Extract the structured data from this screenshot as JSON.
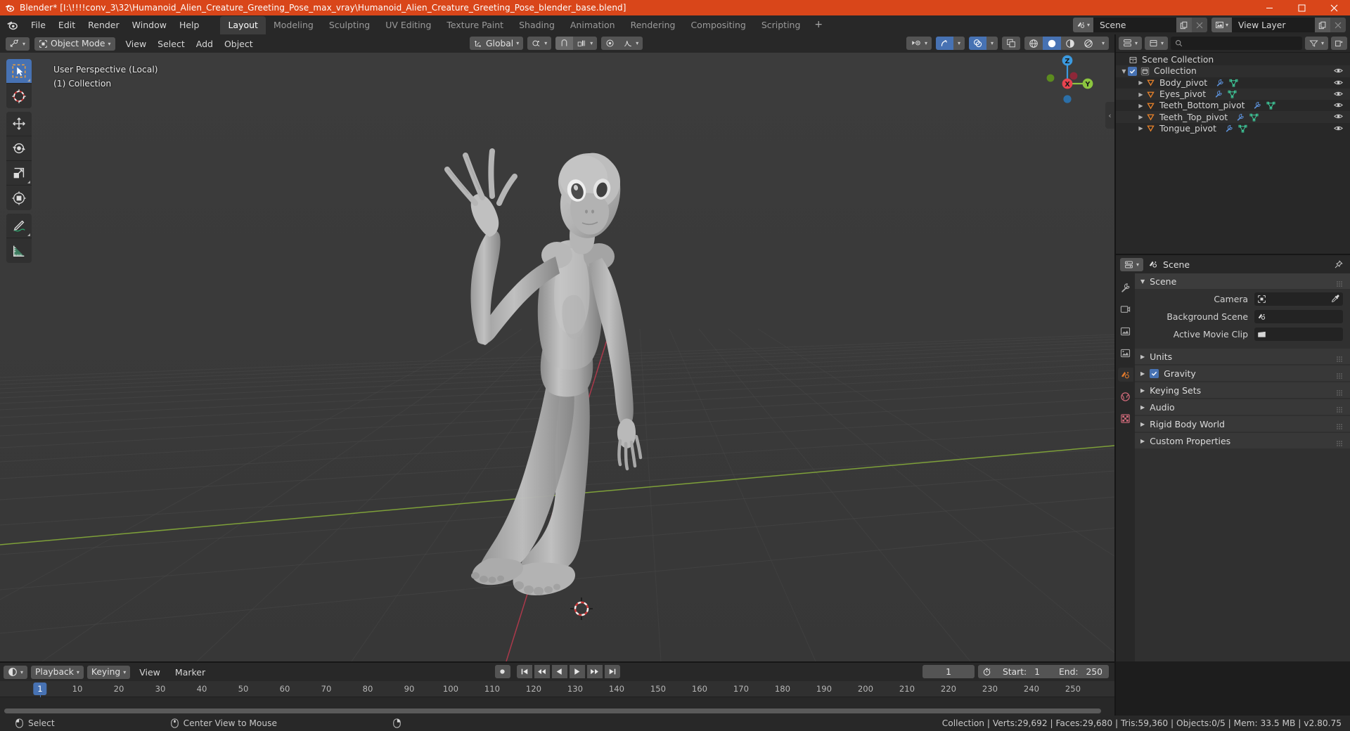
{
  "window": {
    "title": "Blender* [I:\\!!!!conv_3\\32\\Humanoid_Alien_Creature_Greeting_Pose_max_vray\\Humanoid_Alien_Creature_Greeting_Pose_blender_base.blend]",
    "minimize_label": "Minimize",
    "maximize_label": "Maximize",
    "close_label": "Close"
  },
  "topbar": {
    "menus": [
      "File",
      "Edit",
      "Render",
      "Window",
      "Help"
    ],
    "workspaces": [
      {
        "label": "Layout",
        "active": true
      },
      {
        "label": "Modeling",
        "active": false
      },
      {
        "label": "Sculpting",
        "active": false
      },
      {
        "label": "UV Editing",
        "active": false
      },
      {
        "label": "Texture Paint",
        "active": false
      },
      {
        "label": "Shading",
        "active": false
      },
      {
        "label": "Animation",
        "active": false
      },
      {
        "label": "Rendering",
        "active": false
      },
      {
        "label": "Compositing",
        "active": false
      },
      {
        "label": "Scripting",
        "active": false
      }
    ],
    "add_workspace": "+",
    "scene_name": "Scene",
    "view_layer_name": "View Layer"
  },
  "viewport": {
    "mode": "Object Mode",
    "menus": [
      "View",
      "Select",
      "Add",
      "Object"
    ],
    "transform_orientation": "Global",
    "overlay_line1": "User Perspective (Local)",
    "overlay_line2": "(1) Collection",
    "gizmo_axes": {
      "x": "X",
      "y": "Y",
      "z": "Z"
    },
    "tools": [
      "select-box-tool",
      "cursor-tool",
      "move-tool",
      "rotate-tool",
      "scale-tool",
      "transform-tool",
      "annotate-tool",
      "measure-tool"
    ]
  },
  "outliner": {
    "search_placeholder": "",
    "rows": [
      {
        "label": "Scene Collection",
        "depth": 0,
        "icon": "collection-icon",
        "expandable": false,
        "checkbox": false,
        "modifier_icons": [],
        "eye": false
      },
      {
        "label": "Collection",
        "depth": 1,
        "icon": "collection-icon",
        "expandable": true,
        "checkbox": true,
        "modifier_icons": [],
        "eye": true
      },
      {
        "label": "Body_pivot",
        "depth": 2,
        "icon": "empty-icon",
        "expandable": true,
        "checkbox": false,
        "modifier_icons": [
          "wrench-icon",
          "mesh-data-icon"
        ],
        "eye": true
      },
      {
        "label": "Eyes_pivot",
        "depth": 2,
        "icon": "empty-icon",
        "expandable": true,
        "checkbox": false,
        "modifier_icons": [
          "wrench-icon",
          "mesh-data-icon"
        ],
        "eye": true
      },
      {
        "label": "Teeth_Bottom_pivot",
        "depth": 2,
        "icon": "empty-icon",
        "expandable": true,
        "checkbox": false,
        "modifier_icons": [
          "wrench-icon",
          "mesh-data-icon"
        ],
        "eye": true
      },
      {
        "label": "Teeth_Top_pivot",
        "depth": 2,
        "icon": "empty-icon",
        "expandable": true,
        "checkbox": false,
        "modifier_icons": [
          "wrench-icon",
          "mesh-data-icon"
        ],
        "eye": true
      },
      {
        "label": "Tongue_pivot",
        "depth": 2,
        "icon": "empty-icon",
        "expandable": true,
        "checkbox": false,
        "modifier_icons": [
          "wrench-icon",
          "mesh-data-icon"
        ],
        "eye": true
      }
    ]
  },
  "properties": {
    "breadcrumb": "Scene",
    "panel_title": "Scene",
    "fields": [
      {
        "label": "Camera",
        "value": "",
        "icon": "camera-icon",
        "eyedropper": true
      },
      {
        "label": "Background Scene",
        "value": "",
        "icon": "scene-icon",
        "eyedropper": false
      },
      {
        "label": "Active Movie Clip",
        "value": "",
        "icon": "clip-icon",
        "eyedropper": false
      }
    ],
    "panels": [
      {
        "label": "Units",
        "checkbox": false
      },
      {
        "label": "Gravity",
        "checkbox": true
      },
      {
        "label": "Keying Sets",
        "checkbox": false
      },
      {
        "label": "Audio",
        "checkbox": false
      },
      {
        "label": "Rigid Body World",
        "checkbox": false
      },
      {
        "label": "Custom Properties",
        "checkbox": false
      }
    ],
    "tabs": [
      "tool-icon",
      "render-icon",
      "output-icon",
      "view-layer-icon",
      "scene-icon",
      "world-icon",
      "texture-icon"
    ]
  },
  "timeline": {
    "menus": [
      "Playback",
      "Keying",
      "View",
      "Marker"
    ],
    "current_frame": "1",
    "start_label": "Start:",
    "start_value": "1",
    "end_label": "End:",
    "end_value": "250",
    "ruler_ticks": [
      "10",
      "20",
      "30",
      "40",
      "50",
      "60",
      "70",
      "80",
      "90",
      "100",
      "110",
      "120",
      "130",
      "140",
      "150",
      "160",
      "170",
      "180",
      "190",
      "200",
      "210",
      "220",
      "230",
      "240",
      "250"
    ],
    "playhead_label": "1"
  },
  "statusbar": {
    "left_items": [
      {
        "icon": "mouse-left-icon",
        "label": "Select"
      },
      {
        "icon": "mouse-middle-icon",
        "label": "Center View to Mouse"
      },
      {
        "icon": "mouse-right-icon",
        "label": ""
      }
    ],
    "stats": "Collection | Verts:29,692 | Faces:29,680 | Tris:59,360 | Objects:0/5 | Mem: 33.5 MB | v2.80.75"
  },
  "colors": {
    "title_bar": "#d9461a",
    "accent_blue": "#4772b3",
    "panel_bg": "#282828",
    "viewport_bg": "#393939",
    "axis_x": "#ce3b54",
    "axis_y": "#99c441",
    "empty_orange": "#e9822a"
  }
}
